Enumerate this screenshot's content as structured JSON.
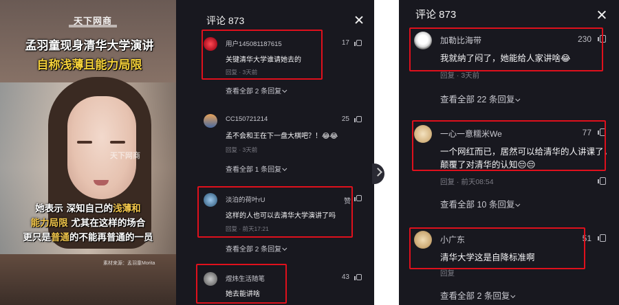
{
  "video": {
    "logo": "天下网商",
    "watermark": "天下网商",
    "title_line1": "孟羽童现身清华大学演讲",
    "title_line2": "自称浅薄且能力局限",
    "subtitle_part1": "她表示 深知自己的",
    "subtitle_hl1": "浅薄和",
    "subtitle_hl2": "能力局限",
    "subtitle_part2": " 尤其在这样的场合",
    "subtitle_part3": "更只是",
    "subtitle_hl3": "普通",
    "subtitle_part4": "的不能再普通的一员",
    "credit": "素材来源：孟羽童Morita"
  },
  "mid_panel": {
    "header": "评论 873",
    "comments": [
      {
        "user": "用户145081187615",
        "text": "关键清华大学谁请她去的",
        "meta": "回复 · 3天前",
        "likes": "17",
        "more": ""
      },
      {
        "user": "CC150721214",
        "text": "孟不会和王在下一盘大棋吧？！😂😂",
        "meta": "回复 · 3天前",
        "likes": "25",
        "more": "查看全部 1 条回复"
      },
      {
        "user": "淡泊的荷叶rU",
        "text": "这样的人也可以去清华大学演讲了吗",
        "meta": "回复 · 前天17:21",
        "likes": "赞",
        "more": "查看全部 2 条回复"
      },
      {
        "user": "煜炜生活随笔",
        "text": "她去能讲啥",
        "meta": "",
        "likes": "43",
        "more": ""
      }
    ],
    "first_more": "查看全部 2 条回复"
  },
  "right_panel": {
    "header": "评论 873",
    "comments": [
      {
        "user": "加勒比海带",
        "text": "我就纳了闷了，她能给人家讲啥😂",
        "meta": "回复 · 3天前",
        "likes": "230",
        "more": "查看全部 22 条回复"
      },
      {
        "user": "一心一意糯米We",
        "text_line1": "一个网红而已，居然可以给清华的人讲课了，",
        "text_line2": "颠覆了对清华的认知😔😔",
        "meta": "回复 · 前天08:54",
        "likes": "77",
        "more": "查看全部 10 条回复"
      },
      {
        "user": "小广东",
        "text": "清华大学这是自降标准啊",
        "meta": "回复",
        "likes": "51",
        "more": "查看全部 2 条回复"
      }
    ]
  },
  "colors": {
    "panel_bg": "#18181f",
    "highlight_box": "#e0101c",
    "subtitle_highlight": "#f2c64b",
    "title_yellow": "#f5d13a"
  }
}
